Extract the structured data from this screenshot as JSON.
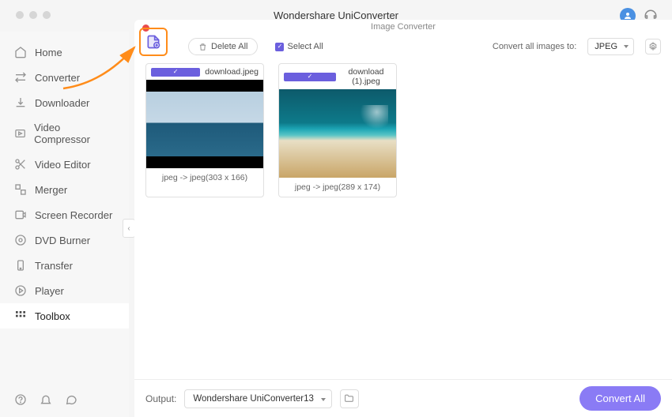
{
  "app_title": "Wondershare UniConverter",
  "subtitle": "Image Converter",
  "sidebar": {
    "items": [
      {
        "label": "Home"
      },
      {
        "label": "Converter"
      },
      {
        "label": "Downloader"
      },
      {
        "label": "Video Compressor"
      },
      {
        "label": "Video Editor"
      },
      {
        "label": "Merger"
      },
      {
        "label": "Screen Recorder"
      },
      {
        "label": "DVD Burner"
      },
      {
        "label": "Transfer"
      },
      {
        "label": "Player"
      },
      {
        "label": "Toolbox"
      }
    ]
  },
  "toolbar": {
    "delete_all": "Delete All",
    "select_all": "Select All",
    "convert_to_label": "Convert all images to:",
    "format": "JPEG"
  },
  "files": [
    {
      "name": "download.jpeg",
      "info": "jpeg -> jpeg(303 x 166)"
    },
    {
      "name": "download (1).jpeg",
      "info": "jpeg -> jpeg(289 x 174)"
    }
  ],
  "output": {
    "label": "Output:",
    "path": "Wondershare UniConverter13"
  },
  "convert_all": "Convert All"
}
